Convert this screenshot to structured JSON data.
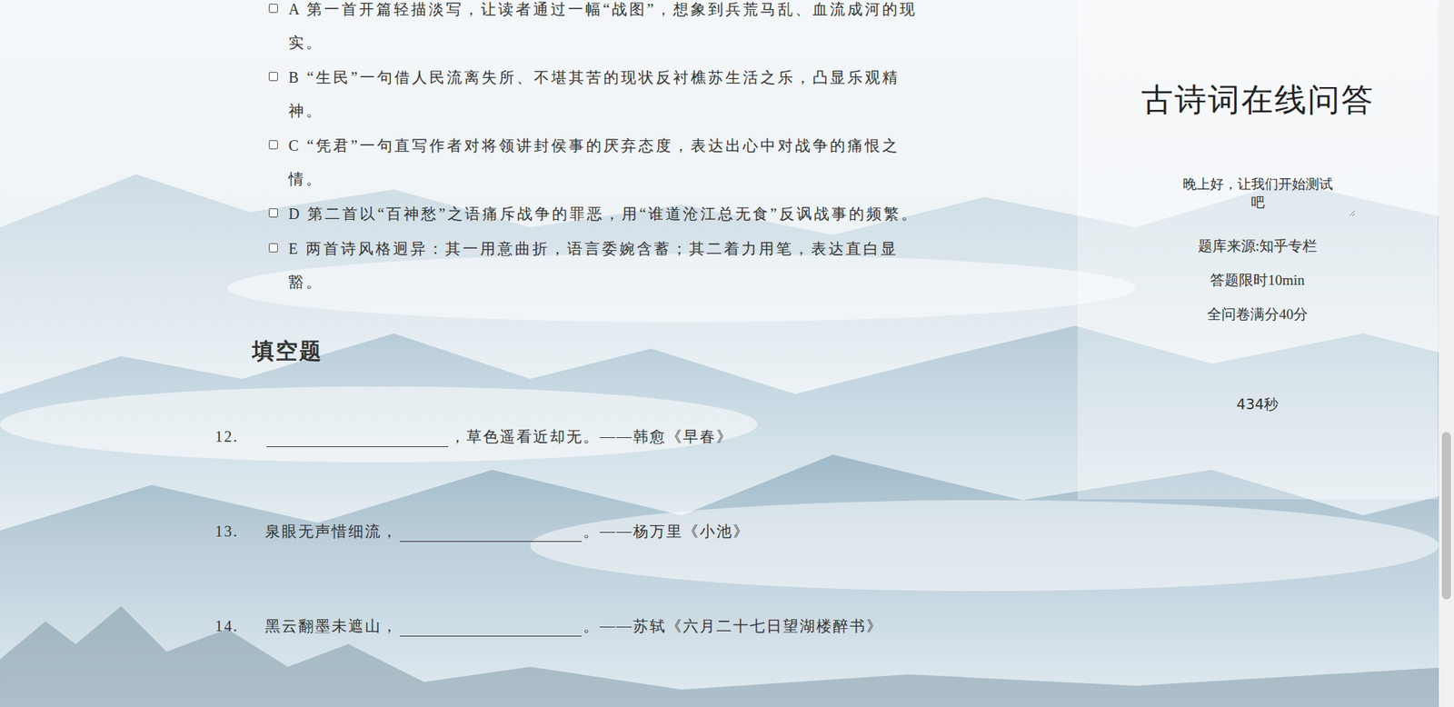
{
  "options": [
    {
      "letter": "A",
      "text": "第一首开篇轻描淡写，让读者通过一幅“战图”，想象到兵荒马乱、血流成河的现实。",
      "checked": false
    },
    {
      "letter": "B",
      "text": "“生民”一句借人民流离失所、不堪其苦的现状反衬樵苏生活之乐，凸显乐观精神。",
      "checked": false
    },
    {
      "letter": "C",
      "text": "“凭君”一句直写作者对将领讲封侯事的厌弃态度，表达出心中对战争的痛恨之情。",
      "checked": false
    },
    {
      "letter": "D",
      "text": "第二首以“百神愁”之语痛斥战争的罪恶，用“谁道沧江总无食”反讽战事的频繁。",
      "checked": false
    },
    {
      "letter": "E",
      "text": "两首诗风格迥异：其一用意曲折，语言委婉含蓄；其二着力用笔，表达直白显豁。",
      "checked": false
    }
  ],
  "section_title": "填空题",
  "blanks": [
    {
      "number": "12.",
      "before": "",
      "after": "，草色遥看近却无。——韩愈《早春》"
    },
    {
      "number": "13.",
      "before": "泉眼无声惜细流，",
      "after": "。——杨万里《小池》"
    },
    {
      "number": "14.",
      "before": "黑云翻墨未遮山，",
      "after": "。——苏轼《六月二十七日望湖楼醉书》"
    }
  ],
  "panel": {
    "title": "古诗词在线问答",
    "greeting": "晚上好，让我们开始测试吧",
    "info": [
      "题库来源:知乎专栏",
      "答题限时10min",
      "全问卷满分40分"
    ],
    "timer": "434秒"
  },
  "scrollbar": {
    "level": 0.8
  }
}
